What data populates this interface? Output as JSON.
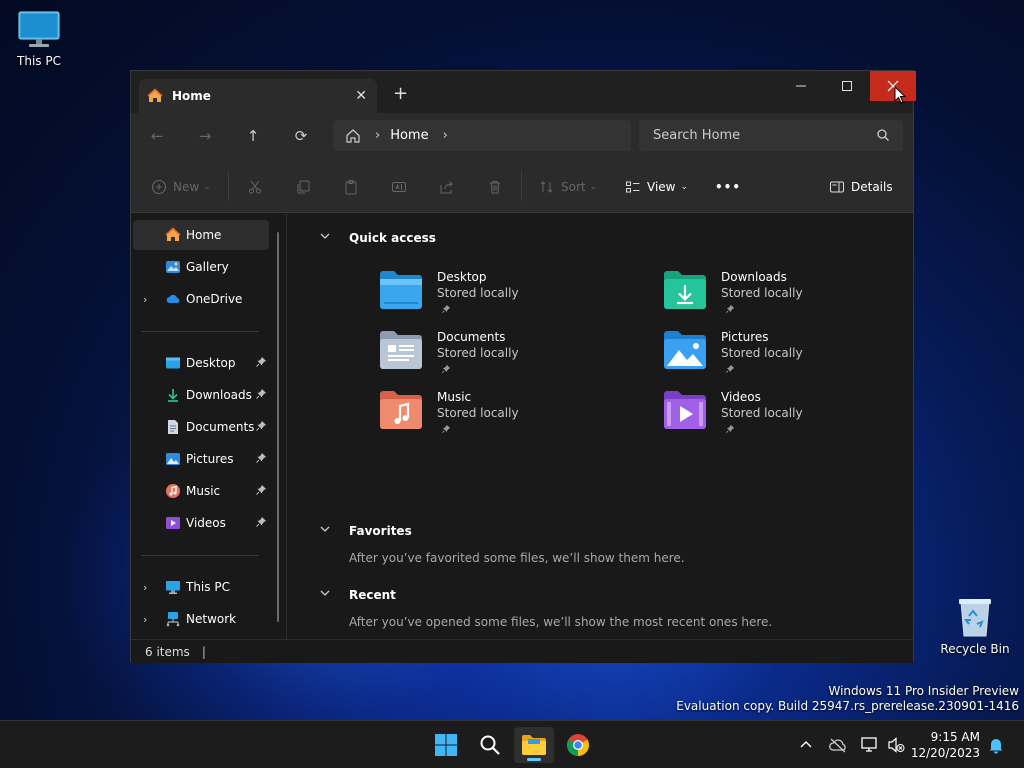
{
  "desktop": {
    "icons": [
      {
        "label": "This PC"
      },
      {
        "label": "Recycle Bin"
      }
    ],
    "watermark": {
      "line1": "Windows 11 Pro Insider Preview",
      "line2": "Evaluation copy. Build 25947.rs_prerelease.230901-1416"
    }
  },
  "window": {
    "tab_title": "Home",
    "tab_close": "✕",
    "new_tab": "+",
    "controls": {
      "minimize": "—",
      "maximize": "☐",
      "close": "✕"
    },
    "nav": {
      "back": "←",
      "forward": "→",
      "up": "↑",
      "refresh": "⟳",
      "breadcrumb": "Home",
      "search_placeholder": "Search Home"
    },
    "toolbar": {
      "new_label": "New",
      "sort_label": "Sort",
      "view_label": "View",
      "more_label": "•••",
      "details_label": "Details"
    },
    "sidebar": {
      "items": [
        {
          "label": "Home"
        },
        {
          "label": "Gallery"
        },
        {
          "label": "OneDrive"
        },
        {
          "label": "Desktop"
        },
        {
          "label": "Downloads"
        },
        {
          "label": "Documents"
        },
        {
          "label": "Pictures"
        },
        {
          "label": "Music"
        },
        {
          "label": "Videos"
        },
        {
          "label": "This PC"
        },
        {
          "label": "Network"
        }
      ]
    },
    "quick_access": {
      "title": "Quick access",
      "items": [
        {
          "name": "Desktop",
          "sub": "Stored locally"
        },
        {
          "name": "Downloads",
          "sub": "Stored locally"
        },
        {
          "name": "Documents",
          "sub": "Stored locally"
        },
        {
          "name": "Pictures",
          "sub": "Stored locally"
        },
        {
          "name": "Music",
          "sub": "Stored locally"
        },
        {
          "name": "Videos",
          "sub": "Stored locally"
        }
      ]
    },
    "favorites": {
      "title": "Favorites",
      "hint": "After you’ve favorited some files, we’ll show them here."
    },
    "recent": {
      "title": "Recent",
      "hint": "After you’ve opened some files, we’ll show the most recent ones here."
    },
    "status": {
      "items": "6 items",
      "sep": "|"
    }
  },
  "taskbar": {
    "clock_time": "9:15 AM",
    "clock_date": "12/20/2023",
    "tray_chevron": "︿"
  },
  "colors": {
    "accent": "#60cdff",
    "close_red": "#c42b1c",
    "folder_blue": "#3b9ae6"
  }
}
